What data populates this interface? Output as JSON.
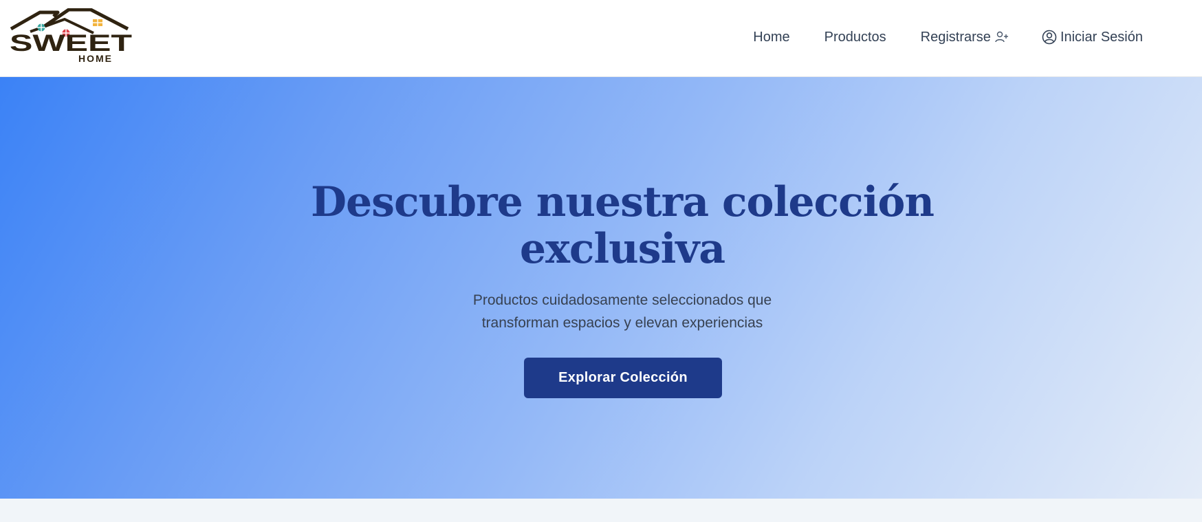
{
  "brand": {
    "logo_main": "SWEET",
    "logo_sub": "HOME"
  },
  "nav": {
    "home": "Home",
    "productos": "Productos",
    "registrarse": "Registrarse",
    "iniciar_sesion": "Iniciar Sesión",
    "icons": [
      "user-plus-icon",
      "user-circle-icon"
    ]
  },
  "hero": {
    "title_line1": "Descubre nuestra colección",
    "title_line2": "exclusiva",
    "subtitle_line1": "Productos cuidadosamente seleccionados que",
    "subtitle_line2": "transforman espacios y elevan experiencias",
    "cta_label": "Explorar Colección"
  },
  "colors": {
    "primary": "#1e3a8a",
    "gradient_start": "#3b82f6",
    "gradient_end": "#e4ecf8",
    "nav_text": "#334155"
  }
}
